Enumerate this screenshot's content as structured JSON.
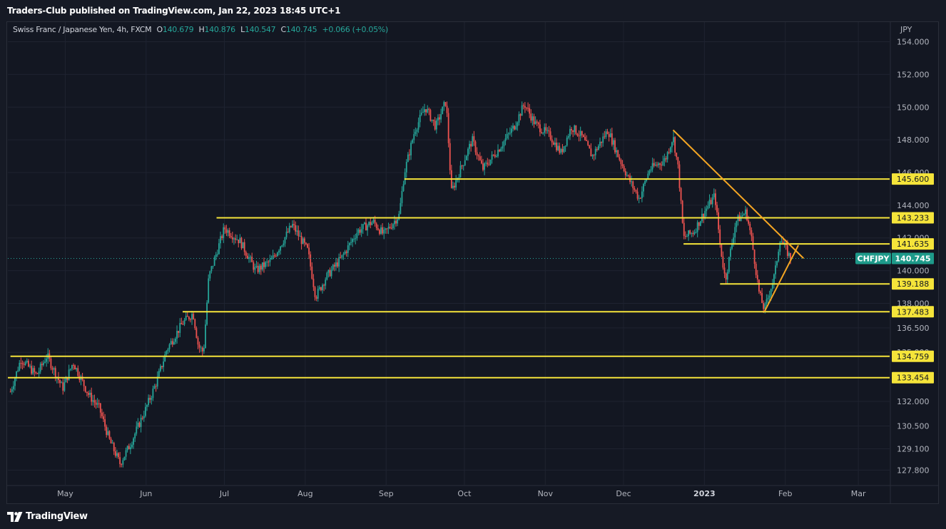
{
  "header": {
    "published": "Traders-Club published on TradingView.com, Jan 22, 2023 18:45 UTC+1"
  },
  "legend": {
    "symbol": "Swiss Franc / Japanese Yen, 4h, FXCM",
    "o_label": "O",
    "o_value": "140.679",
    "h_label": "H",
    "h_value": "140.876",
    "l_label": "L",
    "l_value": "140.547",
    "c_label": "C",
    "c_value": "140.745",
    "change": "+0.066 (+0.05%)"
  },
  "footer": {
    "brand": "TradingView"
  },
  "colors": {
    "up": "#26a69a",
    "down": "#ef5350",
    "level_line": "#f5e43a",
    "trend_line": "#f5a623",
    "ticker_bg": "#1e9a8a"
  },
  "chart_data": {
    "type": "candlestick",
    "symbol": "CHFJPY",
    "currency": "JPY",
    "timeframe": "4h",
    "x_ticks": [
      "May",
      "Jun",
      "Jul",
      "Aug",
      "Sep",
      "Oct",
      "Nov",
      "Dec",
      "2023",
      "Feb",
      "Mar"
    ],
    "x_range": [
      "2022-04-09",
      "2023-03-13"
    ],
    "y_range": [
      126.9,
      155.2
    ],
    "y_ticks": [
      "154.000",
      "152.000",
      "150.000",
      "148.000",
      "146.000",
      "144.000",
      "142.000",
      "140.000",
      "138.000",
      "136.500",
      "135.000",
      "132.000",
      "130.500",
      "129.100",
      "127.800"
    ],
    "last_price": "140.745",
    "ticker_label": "CHFJPY",
    "price_path": [
      [
        "2022-04-10",
        132.6
      ],
      [
        "2022-04-14",
        134.6
      ],
      [
        "2022-04-20",
        133.6
      ],
      [
        "2022-04-24",
        134.8
      ],
      [
        "2022-04-30",
        132.8
      ],
      [
        "2022-05-04",
        134.4
      ],
      [
        "2022-05-10",
        132.4
      ],
      [
        "2022-05-14",
        131.6
      ],
      [
        "2022-05-18",
        129.6
      ],
      [
        "2022-05-22",
        128.2
      ],
      [
        "2022-05-26",
        129.4
      ],
      [
        "2022-06-01",
        131.6
      ],
      [
        "2022-06-05",
        133.2
      ],
      [
        "2022-06-09",
        135.2
      ],
      [
        "2022-06-15",
        136.8
      ],
      [
        "2022-06-19",
        137.4
      ],
      [
        "2022-06-21",
        135.4
      ],
      [
        "2022-06-23",
        135.0
      ],
      [
        "2022-06-25",
        139.6
      ],
      [
        "2022-07-01",
        142.6
      ],
      [
        "2022-07-07",
        141.8
      ],
      [
        "2022-07-13",
        140.0
      ],
      [
        "2022-07-19",
        140.6
      ],
      [
        "2022-07-27",
        142.8
      ],
      [
        "2022-08-02",
        141.2
      ],
      [
        "2022-08-05",
        138.4
      ],
      [
        "2022-08-09",
        139.6
      ],
      [
        "2022-08-15",
        140.8
      ],
      [
        "2022-08-21",
        142.4
      ],
      [
        "2022-08-27",
        143.0
      ],
      [
        "2022-08-31",
        142.2
      ],
      [
        "2022-09-06",
        143.4
      ],
      [
        "2022-09-08",
        146.0
      ],
      [
        "2022-09-12",
        148.6
      ],
      [
        "2022-09-16",
        150.0
      ],
      [
        "2022-09-20",
        148.8
      ],
      [
        "2022-09-24",
        150.4
      ],
      [
        "2022-09-26",
        144.8
      ],
      [
        "2022-09-30",
        146.4
      ],
      [
        "2022-10-04",
        148.0
      ],
      [
        "2022-10-08",
        146.2
      ],
      [
        "2022-10-14",
        147.4
      ],
      [
        "2022-10-20",
        148.8
      ],
      [
        "2022-10-24",
        150.2
      ],
      [
        "2022-10-28",
        149.0
      ],
      [
        "2022-11-03",
        148.2
      ],
      [
        "2022-11-07",
        147.2
      ],
      [
        "2022-11-11",
        148.8
      ],
      [
        "2022-11-15",
        148.2
      ],
      [
        "2022-11-19",
        147.0
      ],
      [
        "2022-11-25",
        148.6
      ],
      [
        "2022-11-29",
        147.0
      ],
      [
        "2022-12-03",
        145.6
      ],
      [
        "2022-12-07",
        144.4
      ],
      [
        "2022-12-11",
        146.2
      ],
      [
        "2022-12-17",
        146.8
      ],
      [
        "2022-12-20",
        148.2
      ],
      [
        "2022-12-22",
        146.2
      ],
      [
        "2022-12-24",
        142.0
      ],
      [
        "2022-12-28",
        142.4
      ],
      [
        "2023-01-01",
        143.6
      ],
      [
        "2023-01-05",
        144.6
      ],
      [
        "2023-01-07",
        141.6
      ],
      [
        "2023-01-09",
        139.4
      ],
      [
        "2023-01-13",
        143.0
      ],
      [
        "2023-01-17",
        143.6
      ],
      [
        "2023-01-19",
        142.0
      ],
      [
        "2023-01-22",
        138.6
      ],
      [
        "2023-01-24",
        137.6
      ],
      [
        "2023-01-28",
        139.8
      ],
      [
        "2023-01-30",
        142.0
      ],
      [
        "2023-02-03",
        140.745
      ]
    ],
    "levels": [
      145.6,
      143.233,
      141.635,
      139.188,
      137.483,
      134.759,
      133.454
    ],
    "level_labels": [
      "145.600",
      "143.233",
      "141.635",
      "139.188",
      "137.483",
      "134.759",
      "133.454"
    ],
    "trendlines": [
      {
        "from": [
          "2022-12-20",
          148.6
        ],
        "to": [
          "2023-02-08",
          140.75
        ]
      },
      {
        "from": [
          "2023-01-24",
          137.483
        ],
        "to": [
          "2023-02-06",
          141.55
        ]
      }
    ]
  }
}
